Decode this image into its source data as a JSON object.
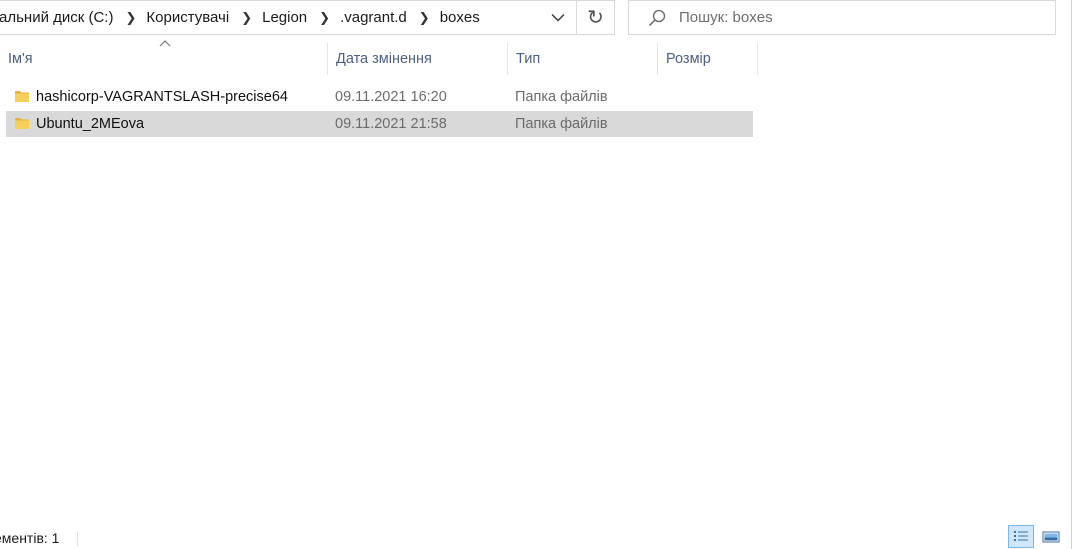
{
  "address_bar": {
    "breadcrumbs": [
      "альний диск (C:)",
      "Користувачі",
      "Legion",
      ".vagrant.d",
      "boxes"
    ]
  },
  "search": {
    "placeholder": "Пошук: boxes"
  },
  "columns": {
    "name": "Ім'я",
    "date": "Дата змінення",
    "type": "Тип",
    "size": "Розмір"
  },
  "files": [
    {
      "name": "hashicorp-VAGRANTSLASH-precise64",
      "date": "09.11.2021 16:20",
      "type": "Папка файлів",
      "icon": "folder-icon",
      "selected": false
    },
    {
      "name": "Ubuntu_2MEova",
      "date": "09.11.2021 21:58",
      "type": "Папка файлів",
      "icon": "folder-icon",
      "selected": true
    }
  ],
  "status_bar": {
    "item_count": "ементів: 1"
  },
  "colors": {
    "header_text": "#4d6082",
    "selection": "#d9d9d9",
    "folder": "#f3c54a",
    "active_view": "#cfe5f8"
  }
}
